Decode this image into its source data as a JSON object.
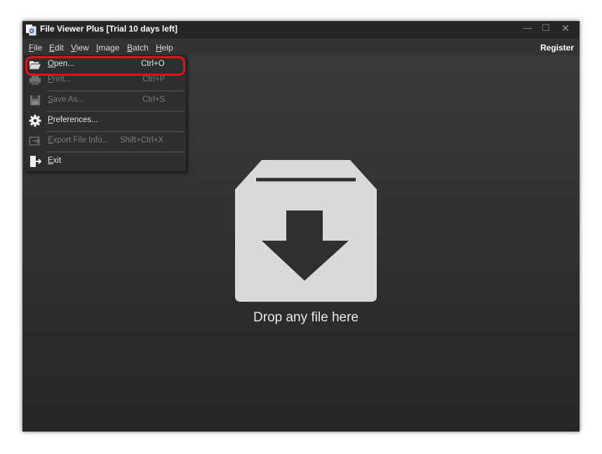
{
  "window": {
    "title": "File Viewer Plus [Trial 10 days left]"
  },
  "title_buttons": {
    "minimize": "—",
    "maximize": "☐",
    "close": "✕"
  },
  "menubar": {
    "items": [
      {
        "first": "F",
        "rest": "ile"
      },
      {
        "first": "E",
        "rest": "dit"
      },
      {
        "first": "V",
        "rest": "iew"
      },
      {
        "first": "I",
        "rest": "mage"
      },
      {
        "first": "B",
        "rest": "atch"
      },
      {
        "first": "H",
        "rest": "elp"
      }
    ],
    "register": "Register"
  },
  "file_menu": {
    "items": [
      {
        "first": "O",
        "rest": "pen...",
        "shortcut": "Ctrl+O",
        "icon": "folder-open-icon",
        "enabled": true
      },
      {
        "first": "P",
        "rest": "rint...",
        "shortcut": "Ctrl+P",
        "icon": "printer-icon",
        "enabled": false
      },
      {
        "first": "S",
        "rest": "ave As...",
        "shortcut": "Ctrl+S",
        "icon": "floppy-disk-icon",
        "enabled": false
      },
      {
        "first": "P",
        "rest": "references...",
        "shortcut": "",
        "icon": "gear-icon",
        "enabled": true
      },
      {
        "first": "E",
        "rest": "xport File Info...",
        "shortcut": "Shift+Ctrl+X",
        "icon": "export-icon",
        "enabled": false
      },
      {
        "first": "E",
        "rest": "xit",
        "shortcut": "",
        "icon": "exit-icon",
        "enabled": true
      }
    ]
  },
  "highlight_color": "#e0131b",
  "main": {
    "drop_text": "Drop any file here",
    "icon": "box-download-icon"
  }
}
